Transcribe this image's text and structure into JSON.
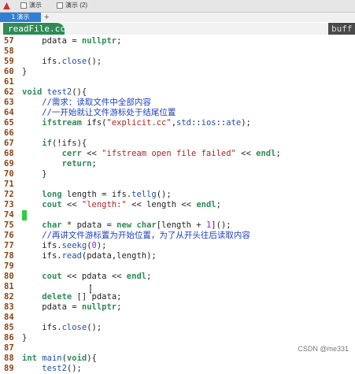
{
  "toolbar": {
    "tab_a_label": "演示",
    "tab_b_label": "演示 (2)"
  },
  "tabs": {
    "active_label": "1 演示",
    "add_label": "+"
  },
  "editor": {
    "file_tab": "readFile.cc",
    "buffers_label": "buff"
  },
  "lines": [
    {
      "n": "57",
      "t": "    pdata = nullptr;"
    },
    {
      "n": "58",
      "t": ""
    },
    {
      "n": "59",
      "t": "    ifs.close();"
    },
    {
      "n": "60",
      "t": "}"
    },
    {
      "n": "61",
      "t": ""
    },
    {
      "n": "62",
      "t": "void test2(){"
    },
    {
      "n": "63",
      "t": "    //需求：读取文件中全部内容"
    },
    {
      "n": "64",
      "t": "    //一开始就让文件游标处于结尾位置"
    },
    {
      "n": "65",
      "t": "    ifstream ifs(\"explicit.cc\",std::ios::ate);"
    },
    {
      "n": "66",
      "t": ""
    },
    {
      "n": "67",
      "t": "    if(!ifs){"
    },
    {
      "n": "68",
      "t": "        cerr << \"ifstream open file failed\" << endl;"
    },
    {
      "n": "69",
      "t": "        return;"
    },
    {
      "n": "70",
      "t": "    }"
    },
    {
      "n": "71",
      "t": ""
    },
    {
      "n": "72",
      "t": "    long length = ifs.tellg();"
    },
    {
      "n": "73",
      "t": "    cout << \"length:\" << length << endl;"
    },
    {
      "n": "74",
      "t": ""
    },
    {
      "n": "75",
      "t": "    char * pdata = new char[length + 1]();"
    },
    {
      "n": "76",
      "t": "    //再讲文件游标置为开始位置，为了从开头往后读取内容"
    },
    {
      "n": "77",
      "t": "    ifs.seekg(0);"
    },
    {
      "n": "78",
      "t": "    ifs.read(pdata,length);"
    },
    {
      "n": "79",
      "t": ""
    },
    {
      "n": "80",
      "t": "    cout << pdata << endl;"
    },
    {
      "n": "81",
      "t": ""
    },
    {
      "n": "82",
      "t": "    delete [] pdata;"
    },
    {
      "n": "83",
      "t": "    pdata = nullptr;"
    },
    {
      "n": "84",
      "t": ""
    },
    {
      "n": "85",
      "t": "    ifs.close();"
    },
    {
      "n": "86",
      "t": "}"
    },
    {
      "n": "87",
      "t": ""
    },
    {
      "n": "88",
      "t": "int main(void){"
    },
    {
      "n": "89",
      "t": "    test2();"
    }
  ],
  "watermark": "CSDN @me331",
  "colors": {
    "keyword": "#2e8b57",
    "string": "#b22222",
    "number": "#a020f0",
    "comment": "#1c3fbf",
    "line_number": "#8b4513",
    "tab_active": "#2f7fd6",
    "file_tab": "#2e8b57",
    "cursor": "#2ecc40"
  },
  "icons": [
    "app-icon",
    "window-icon",
    "mouse-caret-icon"
  ]
}
